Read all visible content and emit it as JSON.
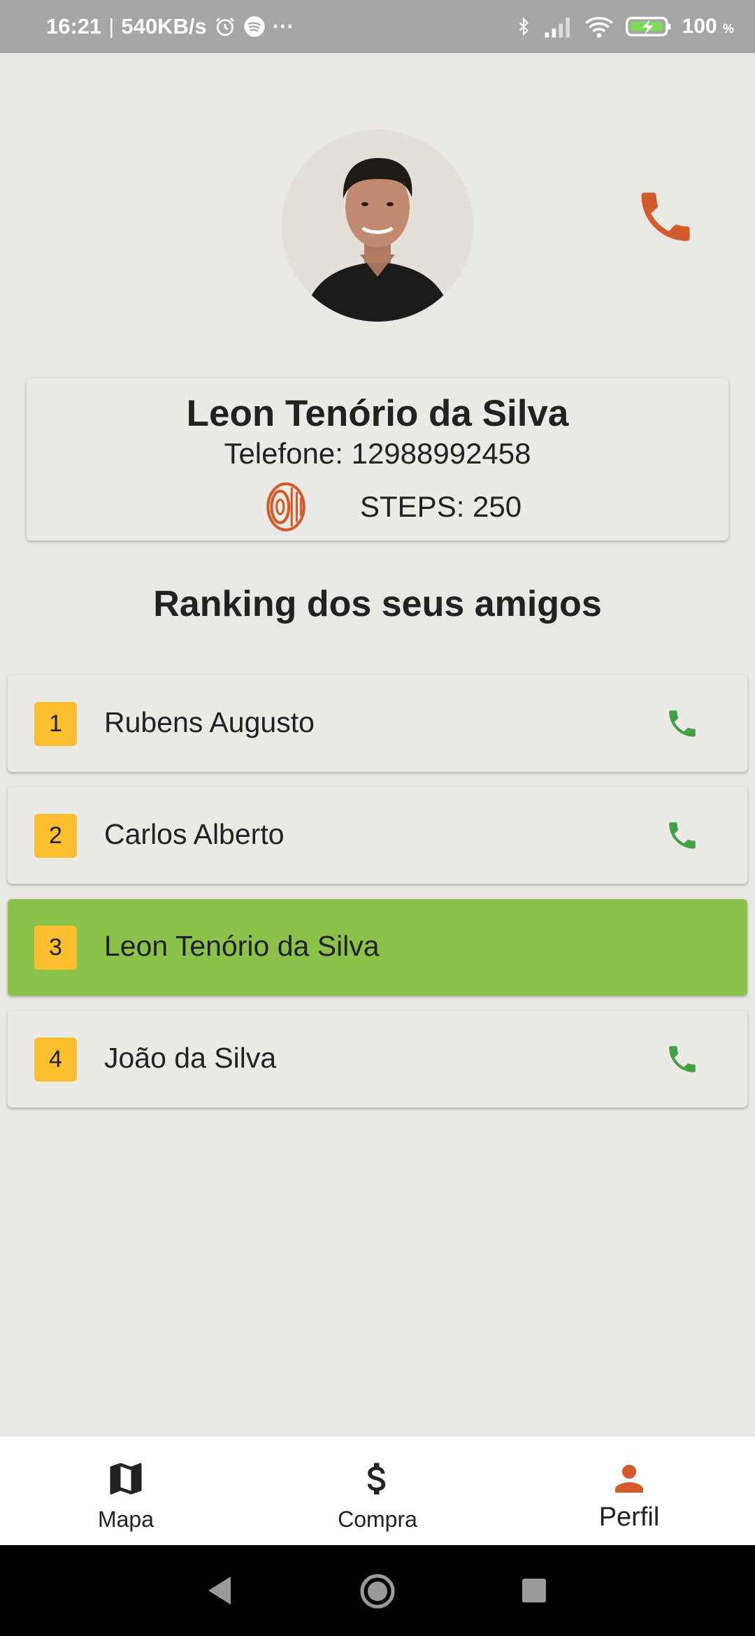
{
  "status_bar": {
    "time": "16:21",
    "separator": "|",
    "net_speed": "540KB/s",
    "more": "···",
    "battery_percent": "100",
    "battery_unit": "%",
    "icons": [
      "alarm-icon",
      "spotify-icon",
      "bluetooth-icon",
      "signal-icon",
      "wifi-icon",
      "battery-charging-icon"
    ]
  },
  "profile": {
    "name": "Leon Tenório da Silva",
    "phone_label": "Telefone: 12988992458",
    "steps_label": "STEPS: 250",
    "call_icon": "phone-icon",
    "steps_icon": "tire-icon"
  },
  "ranking": {
    "title": "Ranking dos seus amigos",
    "items": [
      {
        "rank": "1",
        "name": "Rubens Augusto",
        "has_call": true,
        "highlighted": false
      },
      {
        "rank": "2",
        "name": "Carlos Alberto",
        "has_call": true,
        "highlighted": false
      },
      {
        "rank": "3",
        "name": "Leon Tenório da Silva",
        "has_call": false,
        "highlighted": true
      },
      {
        "rank": "4",
        "name": "João da Silva",
        "has_call": true,
        "highlighted": false
      }
    ]
  },
  "bottom_nav": {
    "items": [
      {
        "label": "Mapa",
        "icon": "map-icon",
        "active": false
      },
      {
        "label": "Compra",
        "icon": "dollar-icon",
        "active": false
      },
      {
        "label": "Perfil",
        "icon": "person-icon",
        "active": true
      }
    ]
  },
  "colors": {
    "accent": "#d35a2a",
    "call_green": "#43a047",
    "highlight_green": "#8bc34a",
    "badge_yellow": "#fbbe2e",
    "background": "#e9e8e4"
  }
}
